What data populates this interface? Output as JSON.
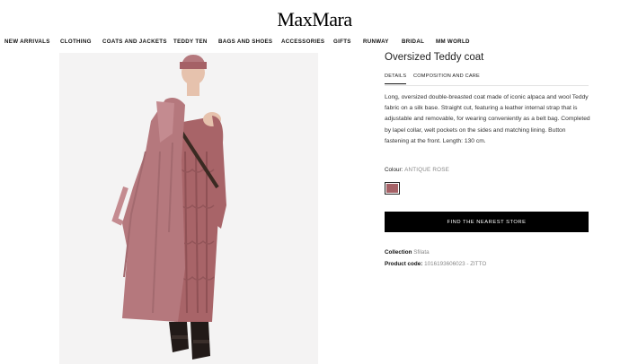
{
  "brand": {
    "logo_text": "MaxMara"
  },
  "nav": {
    "items": [
      "NEW ARRIVALS",
      "CLOTHING",
      "COATS AND JACKETS",
      "TEDDY TEN",
      "BAGS AND SHOES",
      "ACCESSORIES",
      "GIFTS",
      "RUNWAY",
      "BRIDAL",
      "MM WORLD"
    ]
  },
  "product": {
    "title": "Oversized Teddy coat",
    "tabs": {
      "details": "DETAILS",
      "composition": "COMPOSITION AND CARE"
    },
    "description": "Long, oversized double-breasted coat made of iconic alpaca and wool Teddy fabric on a silk base. Straight cut, featuring a leather internal strap that is adjustable and removable, for wearing conveniently as a belt bag. Completed by lapel collar, welt pockets on the sides and matching lining. Button fastening at the front. Length: 130 cm.",
    "colour_label": "Colour:",
    "colour_value": "ANTIQUE ROSE",
    "swatch_color": "#a56166",
    "store_button": "FIND THE NEAREST STORE",
    "collection_label": "Collection",
    "collection_value": "Sfilata",
    "code_label": "Product code:",
    "code_value": "1016193606023 - ZITTO"
  },
  "colors": {
    "coat": "#b5787d",
    "dress": "#a86468",
    "boots": "#221a18",
    "skin": "#e6c2ad"
  }
}
